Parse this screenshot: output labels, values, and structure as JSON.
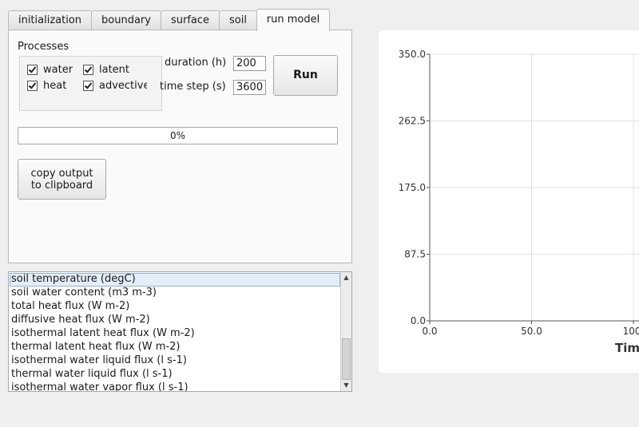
{
  "tabs": [
    {
      "label": "initialization",
      "active": false
    },
    {
      "label": "boundary",
      "active": false
    },
    {
      "label": "surface",
      "active": false
    },
    {
      "label": "soil",
      "active": false
    },
    {
      "label": "run model",
      "active": true
    }
  ],
  "run_model": {
    "processes_title": "Processes",
    "processes": [
      {
        "label": "water",
        "checked": true
      },
      {
        "label": "latent",
        "checked": true
      },
      {
        "label": "heat",
        "checked": true
      },
      {
        "label": "advective",
        "checked": true
      }
    ],
    "duration_label": "duration (h)",
    "duration_value": "200",
    "time_step_label": "time step (s)",
    "time_step_value": "3600",
    "run_label": "Run",
    "progress_value": 0,
    "progress_text": "0%",
    "copy_line1": "copy output",
    "copy_line2": "to clipboard"
  },
  "output_list": {
    "items": [
      "soil temperature (degC)",
      "soil water content (m3 m-3)",
      "total heat flux (W m-2)",
      "diffusive heat flux (W m-2)",
      "isothermal latent heat flux (W m-2)",
      "thermal latent heat flux (W m-2)",
      "isothermal water liquid flux (l s-1)",
      "thermal water liquid flux (l s-1)",
      "isothermal water vapor flux (l s-1)"
    ],
    "selected_index": 0,
    "scroll_up_icon": "triangle-up-icon",
    "scroll_down_icon": "triangle-down-icon"
  },
  "chart_data": {
    "type": "line",
    "series": [],
    "ylim": [
      0,
      350
    ],
    "yticks": [
      "0.0",
      "87.5",
      "175.0",
      "262.5",
      "350.0"
    ],
    "xticks": [
      "0.0",
      "50.0",
      "100."
    ],
    "xlabel": "Tim",
    "grid": true
  },
  "colors": {
    "accent": "#3d8ee0",
    "selection_bg": "#e4eef8",
    "grid": "#e2e2e2"
  }
}
